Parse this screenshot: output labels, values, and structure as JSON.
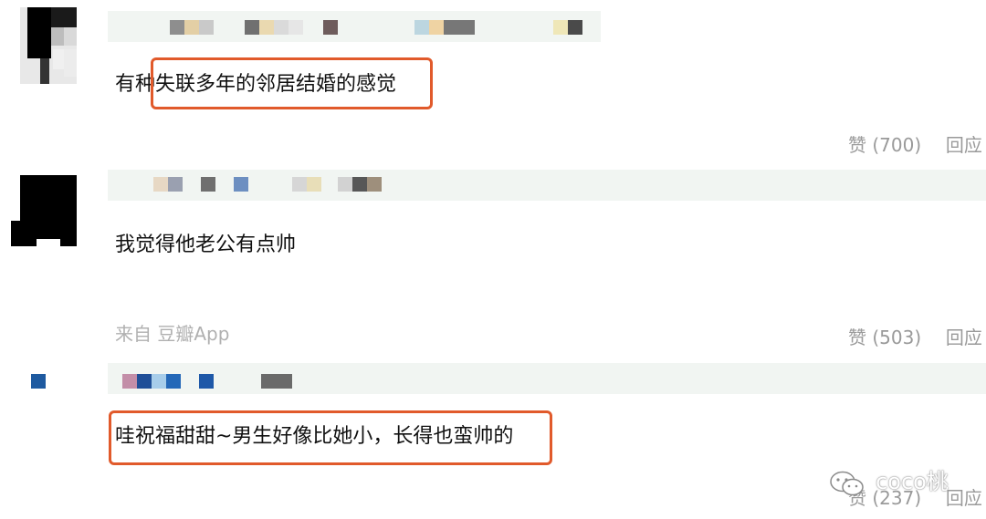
{
  "comments": [
    {
      "text": "有种失联多年的邻居结婚的感觉",
      "like_label": "赞",
      "like_count": "(700)",
      "reply_label": "回应"
    },
    {
      "text": "我觉得他老公有点帅",
      "source": "来自 豆瓣App",
      "like_label": "赞",
      "like_count": "(503)",
      "reply_label": "回应"
    },
    {
      "text": "哇祝福甜甜~男生好像比她小，长得也蛮帅的",
      "like_label": "赞",
      "like_count": "(237)",
      "reply_label": "回应"
    }
  ],
  "watermark": {
    "icon": "wechat-icon",
    "text": "coco桃"
  },
  "colors": {
    "highlight": "#e15a2b",
    "meta_text": "#9a9a9a",
    "name_bar": "#f1f5f2"
  }
}
